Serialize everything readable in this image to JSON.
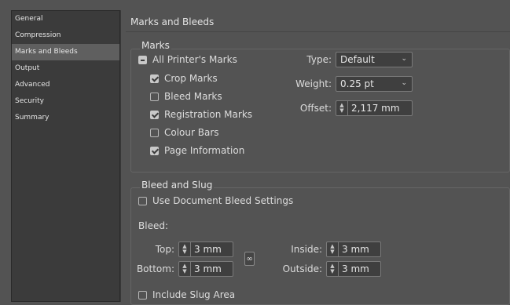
{
  "sidebar": {
    "items": [
      {
        "label": "General",
        "selected": false
      },
      {
        "label": "Compression",
        "selected": false
      },
      {
        "label": "Marks and Bleeds",
        "selected": true
      },
      {
        "label": "Output",
        "selected": false
      },
      {
        "label": "Advanced",
        "selected": false
      },
      {
        "label": "Security",
        "selected": false
      },
      {
        "label": "Summary",
        "selected": false
      }
    ]
  },
  "main": {
    "title": "Marks and Bleeds"
  },
  "marks": {
    "group_label": "Marks",
    "all_printers_marks": {
      "label": "All Printer's Marks",
      "state": "mixed"
    },
    "crop_marks": {
      "label": "Crop Marks",
      "checked": true
    },
    "bleed_marks": {
      "label": "Bleed Marks",
      "checked": false
    },
    "registration_marks": {
      "label": "Registration Marks",
      "checked": true
    },
    "colour_bars": {
      "label": "Colour Bars",
      "checked": false
    },
    "page_information": {
      "label": "Page Information",
      "checked": true
    },
    "type": {
      "label": "Type:",
      "value": "Default"
    },
    "weight": {
      "label": "Weight:",
      "value": "0.25 pt"
    },
    "offset": {
      "label": "Offset:",
      "value": "2,117 mm"
    }
  },
  "bleed_slug": {
    "group_label": "Bleed and Slug",
    "use_document_bleed": {
      "label": "Use Document Bleed Settings",
      "checked": false
    },
    "bleed_label": "Bleed:",
    "top": {
      "label": "Top:",
      "value": "3 mm"
    },
    "bottom": {
      "label": "Bottom:",
      "value": "3 mm"
    },
    "inside": {
      "label": "Inside:",
      "value": "3 mm"
    },
    "outside": {
      "label": "Outside:",
      "value": "3 mm"
    },
    "include_slug": {
      "label": "Include Slug Area",
      "checked": false
    }
  },
  "icons": {
    "chevron": "chevron-down-icon",
    "spinner": "spinner-arrows-icon",
    "chain": "chain-link-icon"
  },
  "colors": {
    "background": "#535353",
    "sidebar": "#3b3b3b",
    "selected": "#5f5f5f"
  }
}
